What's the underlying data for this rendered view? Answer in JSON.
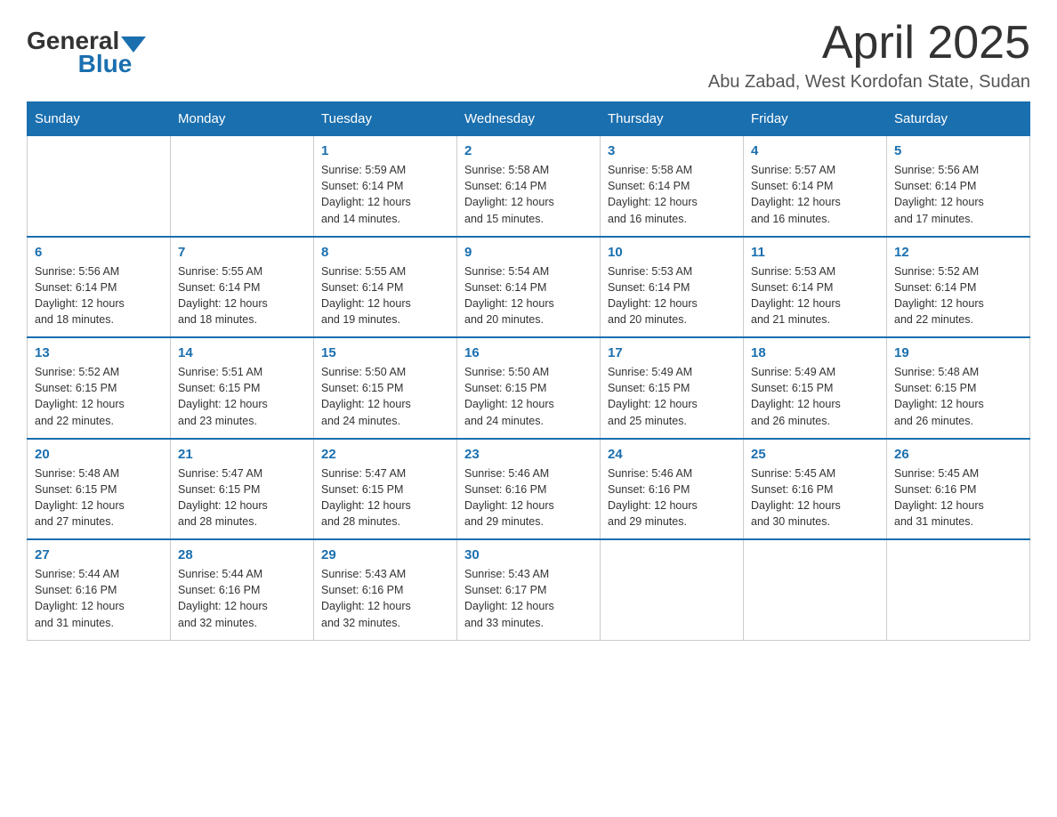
{
  "header": {
    "logo_general": "General",
    "logo_blue": "Blue",
    "month_title": "April 2025",
    "location": "Abu Zabad, West Kordofan State, Sudan"
  },
  "weekdays": [
    "Sunday",
    "Monday",
    "Tuesday",
    "Wednesday",
    "Thursday",
    "Friday",
    "Saturday"
  ],
  "weeks": [
    [
      {
        "day": "",
        "info": ""
      },
      {
        "day": "",
        "info": ""
      },
      {
        "day": "1",
        "info": "Sunrise: 5:59 AM\nSunset: 6:14 PM\nDaylight: 12 hours\nand 14 minutes."
      },
      {
        "day": "2",
        "info": "Sunrise: 5:58 AM\nSunset: 6:14 PM\nDaylight: 12 hours\nand 15 minutes."
      },
      {
        "day": "3",
        "info": "Sunrise: 5:58 AM\nSunset: 6:14 PM\nDaylight: 12 hours\nand 16 minutes."
      },
      {
        "day": "4",
        "info": "Sunrise: 5:57 AM\nSunset: 6:14 PM\nDaylight: 12 hours\nand 16 minutes."
      },
      {
        "day": "5",
        "info": "Sunrise: 5:56 AM\nSunset: 6:14 PM\nDaylight: 12 hours\nand 17 minutes."
      }
    ],
    [
      {
        "day": "6",
        "info": "Sunrise: 5:56 AM\nSunset: 6:14 PM\nDaylight: 12 hours\nand 18 minutes."
      },
      {
        "day": "7",
        "info": "Sunrise: 5:55 AM\nSunset: 6:14 PM\nDaylight: 12 hours\nand 18 minutes."
      },
      {
        "day": "8",
        "info": "Sunrise: 5:55 AM\nSunset: 6:14 PM\nDaylight: 12 hours\nand 19 minutes."
      },
      {
        "day": "9",
        "info": "Sunrise: 5:54 AM\nSunset: 6:14 PM\nDaylight: 12 hours\nand 20 minutes."
      },
      {
        "day": "10",
        "info": "Sunrise: 5:53 AM\nSunset: 6:14 PM\nDaylight: 12 hours\nand 20 minutes."
      },
      {
        "day": "11",
        "info": "Sunrise: 5:53 AM\nSunset: 6:14 PM\nDaylight: 12 hours\nand 21 minutes."
      },
      {
        "day": "12",
        "info": "Sunrise: 5:52 AM\nSunset: 6:14 PM\nDaylight: 12 hours\nand 22 minutes."
      }
    ],
    [
      {
        "day": "13",
        "info": "Sunrise: 5:52 AM\nSunset: 6:15 PM\nDaylight: 12 hours\nand 22 minutes."
      },
      {
        "day": "14",
        "info": "Sunrise: 5:51 AM\nSunset: 6:15 PM\nDaylight: 12 hours\nand 23 minutes."
      },
      {
        "day": "15",
        "info": "Sunrise: 5:50 AM\nSunset: 6:15 PM\nDaylight: 12 hours\nand 24 minutes."
      },
      {
        "day": "16",
        "info": "Sunrise: 5:50 AM\nSunset: 6:15 PM\nDaylight: 12 hours\nand 24 minutes."
      },
      {
        "day": "17",
        "info": "Sunrise: 5:49 AM\nSunset: 6:15 PM\nDaylight: 12 hours\nand 25 minutes."
      },
      {
        "day": "18",
        "info": "Sunrise: 5:49 AM\nSunset: 6:15 PM\nDaylight: 12 hours\nand 26 minutes."
      },
      {
        "day": "19",
        "info": "Sunrise: 5:48 AM\nSunset: 6:15 PM\nDaylight: 12 hours\nand 26 minutes."
      }
    ],
    [
      {
        "day": "20",
        "info": "Sunrise: 5:48 AM\nSunset: 6:15 PM\nDaylight: 12 hours\nand 27 minutes."
      },
      {
        "day": "21",
        "info": "Sunrise: 5:47 AM\nSunset: 6:15 PM\nDaylight: 12 hours\nand 28 minutes."
      },
      {
        "day": "22",
        "info": "Sunrise: 5:47 AM\nSunset: 6:15 PM\nDaylight: 12 hours\nand 28 minutes."
      },
      {
        "day": "23",
        "info": "Sunrise: 5:46 AM\nSunset: 6:16 PM\nDaylight: 12 hours\nand 29 minutes."
      },
      {
        "day": "24",
        "info": "Sunrise: 5:46 AM\nSunset: 6:16 PM\nDaylight: 12 hours\nand 29 minutes."
      },
      {
        "day": "25",
        "info": "Sunrise: 5:45 AM\nSunset: 6:16 PM\nDaylight: 12 hours\nand 30 minutes."
      },
      {
        "day": "26",
        "info": "Sunrise: 5:45 AM\nSunset: 6:16 PM\nDaylight: 12 hours\nand 31 minutes."
      }
    ],
    [
      {
        "day": "27",
        "info": "Sunrise: 5:44 AM\nSunset: 6:16 PM\nDaylight: 12 hours\nand 31 minutes."
      },
      {
        "day": "28",
        "info": "Sunrise: 5:44 AM\nSunset: 6:16 PM\nDaylight: 12 hours\nand 32 minutes."
      },
      {
        "day": "29",
        "info": "Sunrise: 5:43 AM\nSunset: 6:16 PM\nDaylight: 12 hours\nand 32 minutes."
      },
      {
        "day": "30",
        "info": "Sunrise: 5:43 AM\nSunset: 6:17 PM\nDaylight: 12 hours\nand 33 minutes."
      },
      {
        "day": "",
        "info": ""
      },
      {
        "day": "",
        "info": ""
      },
      {
        "day": "",
        "info": ""
      }
    ]
  ]
}
